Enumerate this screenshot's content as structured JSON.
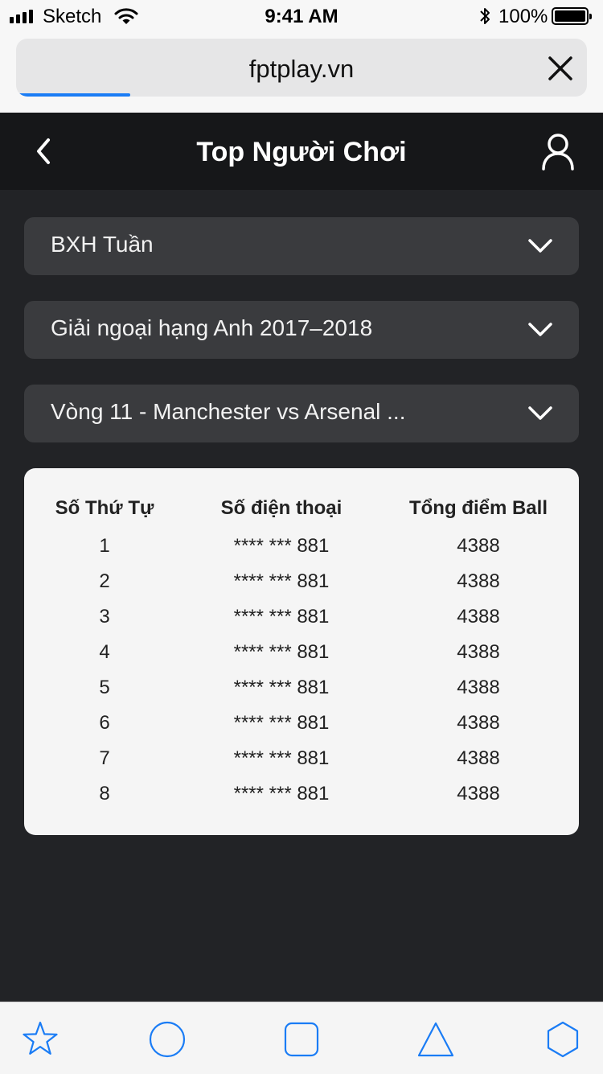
{
  "status_bar": {
    "carrier": "Sketch",
    "time": "9:41 AM",
    "battery_percent": "100%"
  },
  "browser": {
    "url": "fptplay.vn",
    "load_progress": 0.2
  },
  "header": {
    "title": "Top Người Chơi"
  },
  "filters": [
    {
      "label": "BXH Tuần"
    },
    {
      "label": "Giải ngoại hạng Anh 2017–2018"
    },
    {
      "label": "Vòng 11 - Manchester vs Arsenal ..."
    }
  ],
  "leaderboard": {
    "columns": [
      "Số Thứ Tự",
      "Số điện thoại",
      "Tổng điểm Ball"
    ],
    "rows": [
      [
        "1",
        "**** *** 881",
        "4388"
      ],
      [
        "2",
        "**** *** 881",
        "4388"
      ],
      [
        "3",
        "**** *** 881",
        "4388"
      ],
      [
        "4",
        "**** *** 881",
        "4388"
      ],
      [
        "5",
        "**** *** 881",
        "4388"
      ],
      [
        "6",
        "**** *** 881",
        "4388"
      ],
      [
        "7",
        "**** *** 881",
        "4388"
      ],
      [
        "8",
        "**** *** 881",
        "4388"
      ]
    ]
  },
  "tab_bar": {
    "icons": [
      "star-icon",
      "circle-icon",
      "square-icon",
      "triangle-icon",
      "hexagon-icon"
    ],
    "accent": "#1a7cf5"
  },
  "colors": {
    "background": "#222326",
    "nav_background": "#161719",
    "dropdown_background": "#3a3b3e",
    "card_background": "#f5f5f5",
    "progress": "#1a7cf5"
  }
}
